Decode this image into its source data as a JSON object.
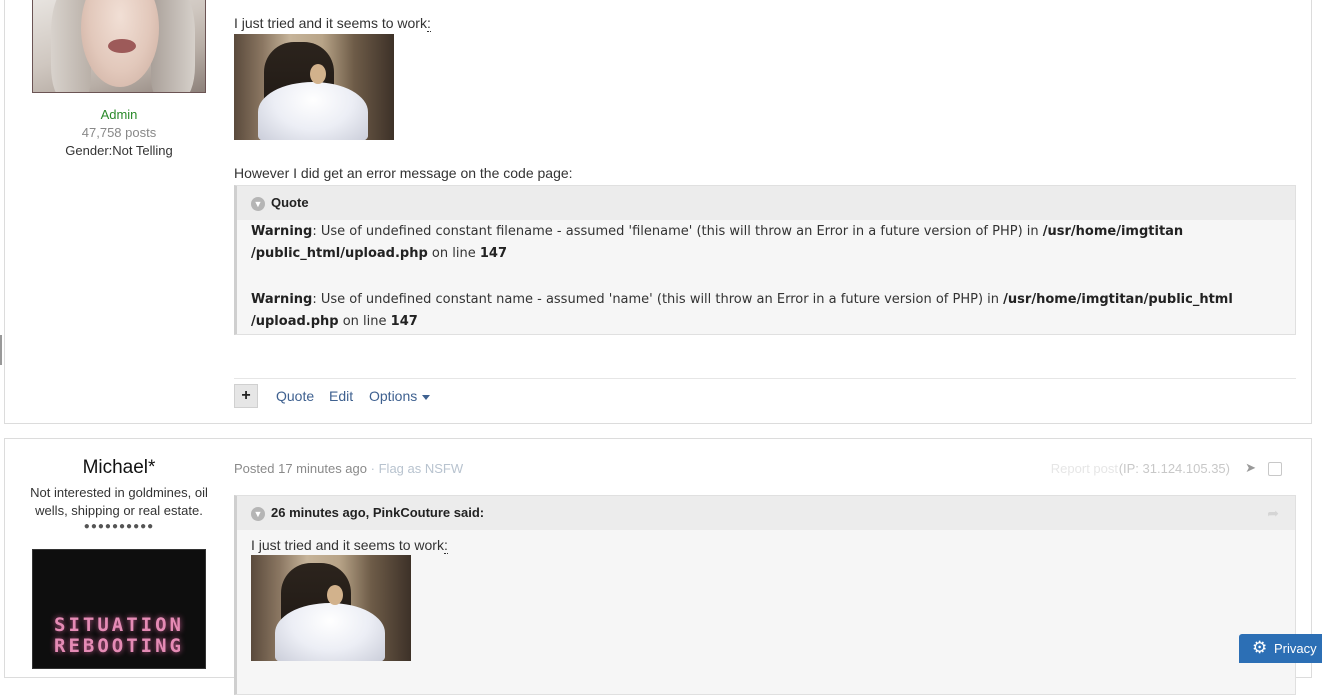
{
  "post1": {
    "author": {
      "rank": "Admin",
      "posts": "47,758 posts",
      "gender": "Gender:Not Telling"
    },
    "text1": "I just tried and it seems to work",
    "text1_colon": ":",
    "text2": "However I did get an error message on the code page:",
    "quote": {
      "title": "Quote",
      "warning1": {
        "label": "Warning",
        "msg": ": Use of undefined constant filename - assumed 'filename' (this will throw an Error in a future version of PHP) in ",
        "path1": "/usr/home/imgtitan",
        "path2": "/public_html/upload.php",
        "line_text": " on line ",
        "line": "147"
      },
      "warning2": {
        "label": "Warning",
        "msg": ": Use of undefined constant name - assumed 'name' (this will throw an Error in a future version of PHP) in ",
        "path1": "/usr/home/imgtitan/public_html",
        "path2": "/upload.php",
        "line_text": " on line ",
        "line": "147"
      }
    },
    "actions": {
      "plus": "+",
      "quote": "Quote",
      "edit": "Edit",
      "options": "Options"
    }
  },
  "post2": {
    "author": {
      "name": "Michael*",
      "title": "Not interested in goldmines, oil wells, shipping or real estate.",
      "pips": "●●●●●●●●●●",
      "avatar_line1": "SITUATION",
      "avatar_line2": "REBOOTING"
    },
    "meta": {
      "posted": "Posted",
      "time": "17 minutes ago",
      "sep": "·",
      "flag": "Flag as NSFW",
      "report": "Report post",
      "ip": "(IP: 31.124.105.35)"
    },
    "quote": {
      "title": "26 minutes ago, PinkCouture said:",
      "text": "I just tried and it seems to work",
      "text_colon": ":"
    }
  },
  "privacy": {
    "label": "Privacy"
  },
  "icons": [
    "chevron-down-icon",
    "share-icon",
    "gear-icon",
    "caret-down-icon"
  ]
}
